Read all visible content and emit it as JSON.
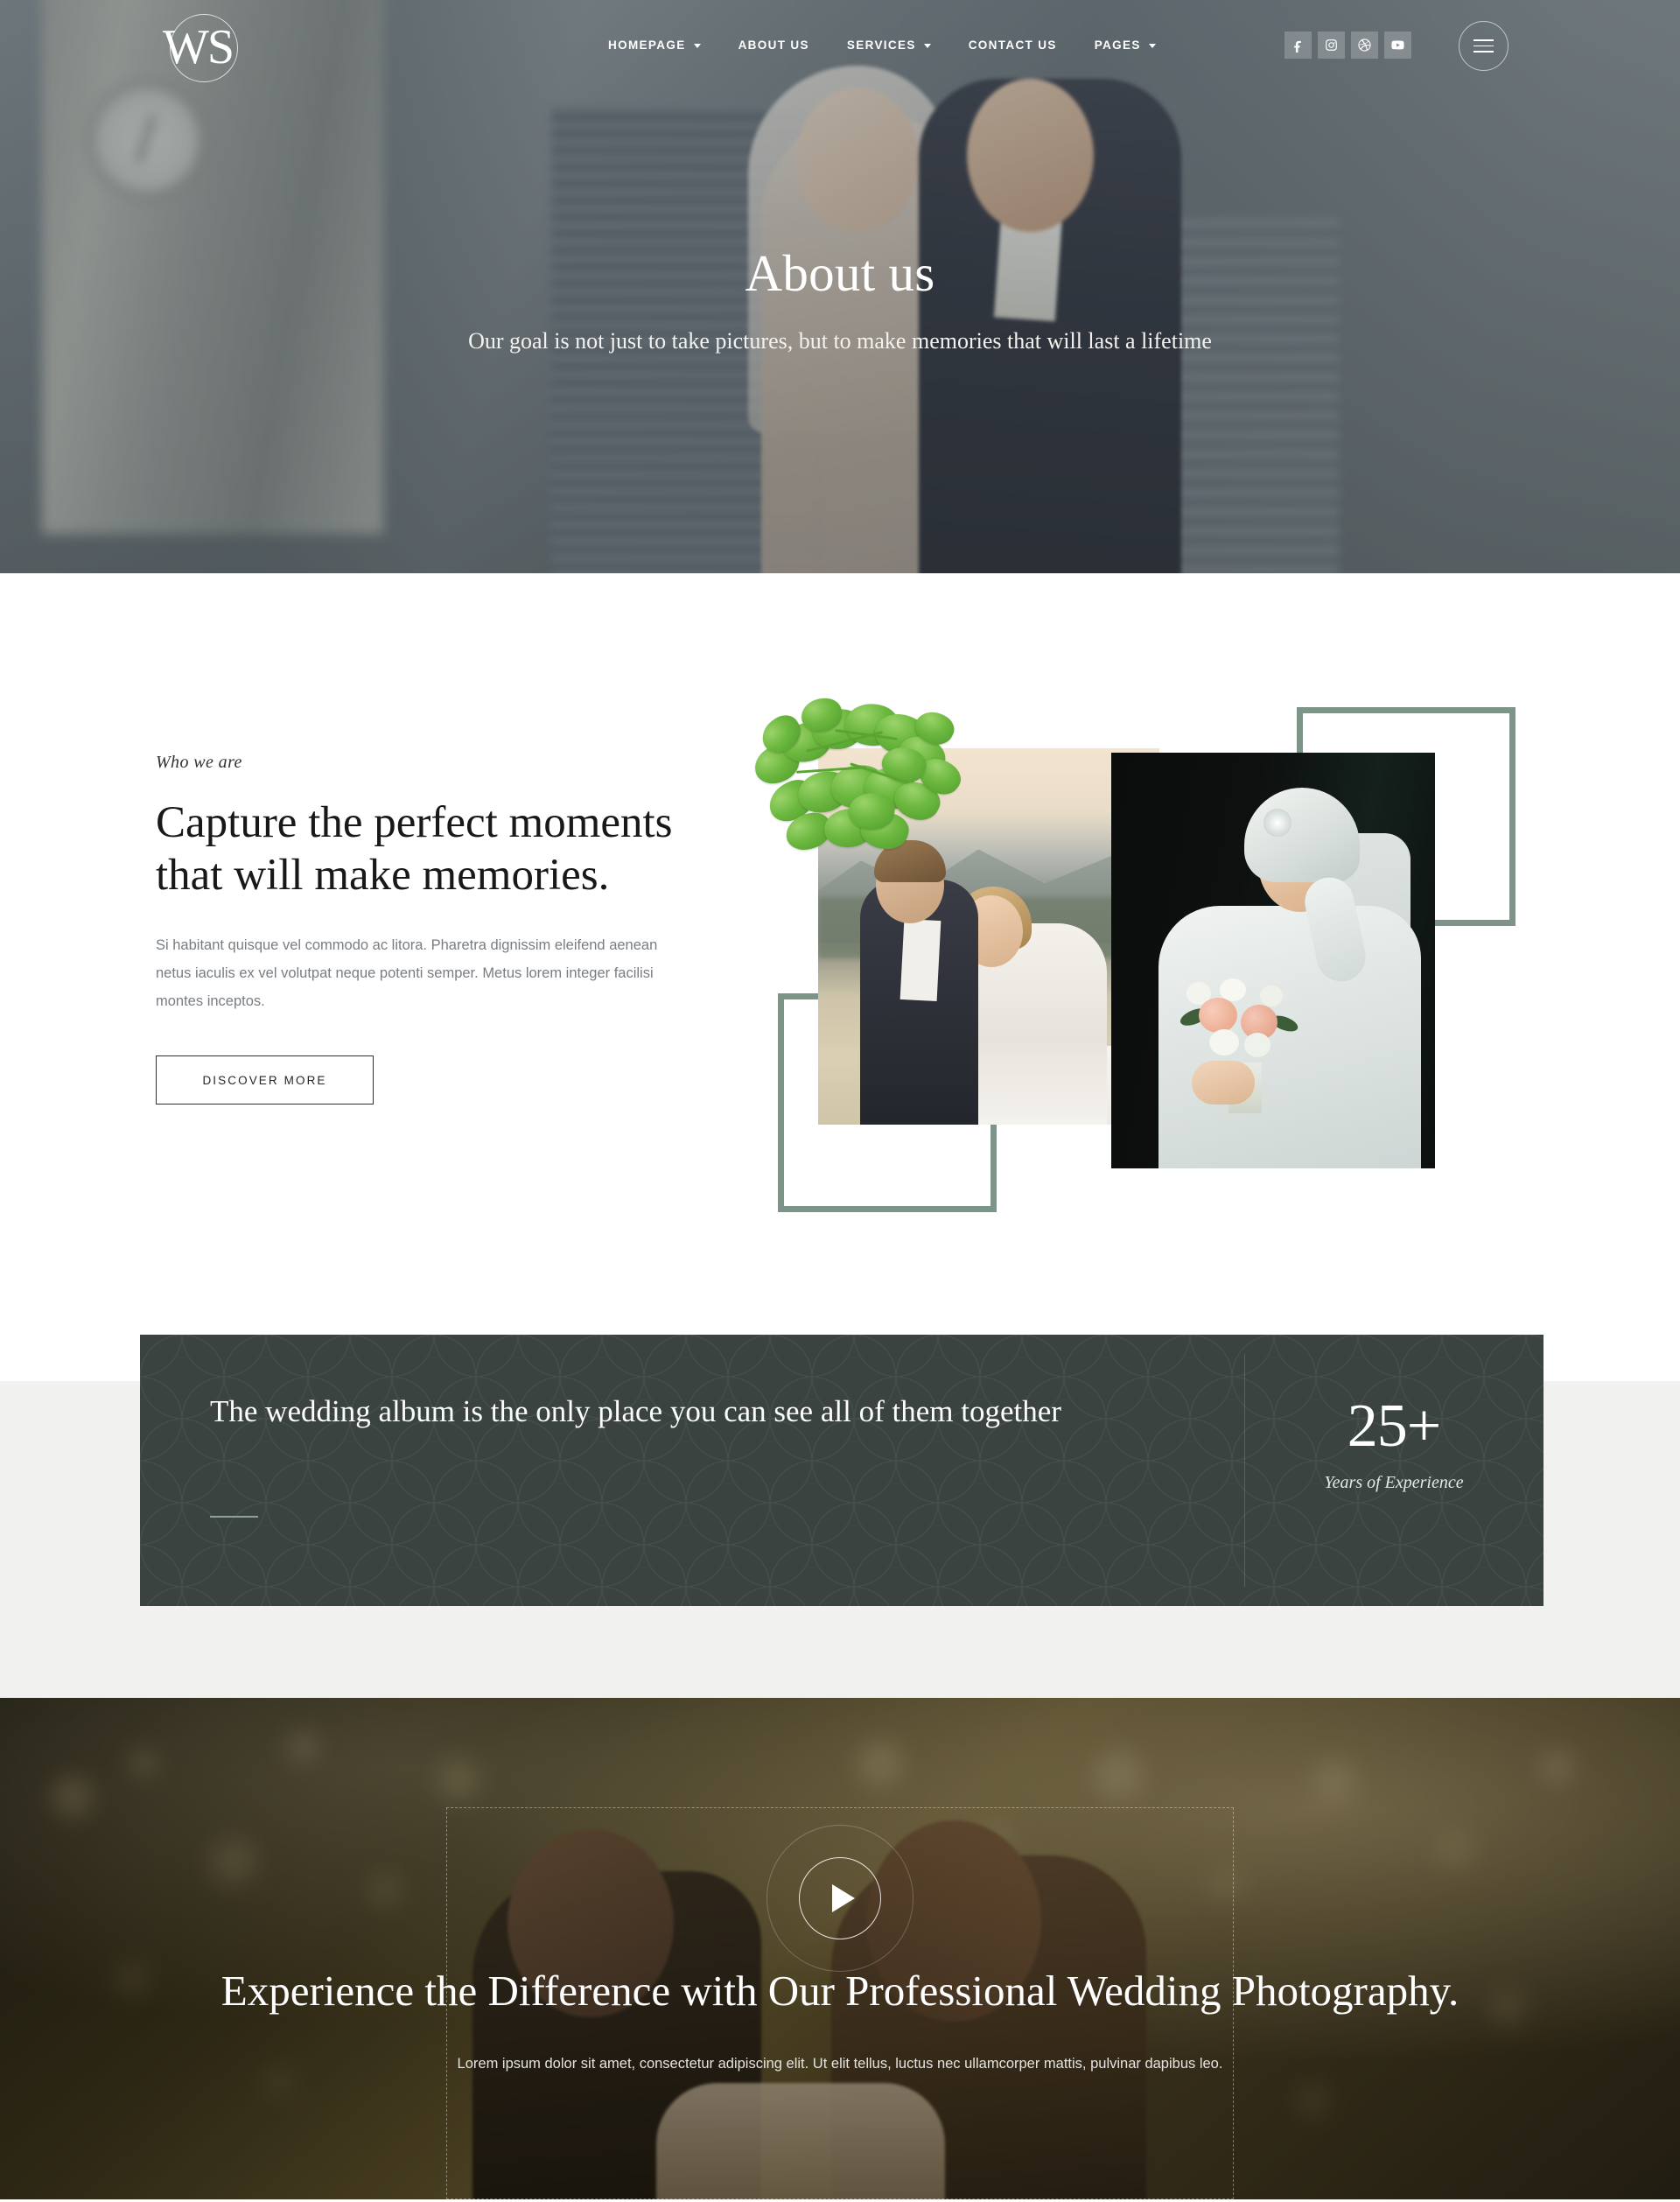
{
  "brand": {
    "logo_text": "WS"
  },
  "nav": {
    "items": [
      {
        "label": "HOMEPAGE",
        "has_caret": true
      },
      {
        "label": "ABOUT US",
        "has_caret": false
      },
      {
        "label": "SERVICES",
        "has_caret": true
      },
      {
        "label": "CONTACT US",
        "has_caret": false
      },
      {
        "label": "PAGES",
        "has_caret": true
      }
    ],
    "socials": [
      "facebook-icon",
      "instagram-icon",
      "dribbble-icon",
      "youtube-icon"
    ],
    "menu_toggle": "hamburger-icon"
  },
  "hero": {
    "title": "About us",
    "subtitle": "Our goal is not just to take pictures, but to make memories that will last a lifetime"
  },
  "about": {
    "eyebrow": "Who we are",
    "heading": "Capture the perfect moments that will make memories.",
    "paragraph": "Si habitant quisque vel commodo ac litora. Pharetra dignissim eleifend aenean netus iaculis ex vel volutpat neque potenti semper. Metus lorem integer facilisi montes inceptos.",
    "cta_label": "DISCOVER MORE"
  },
  "band": {
    "quote": "The wedding album is the only place you can see all of them together",
    "stat_number": "25+",
    "stat_label": "Years of Experience"
  },
  "video": {
    "heading": "Experience the Difference with Our Professional Wedding Photography.",
    "paragraph": "Lorem ipsum dolor sit amet, consectetur adipiscing elit. Ut elit tellus, luctus nec ullamcorper mattis, pulvinar dapibus leo.",
    "play_label": "play-icon"
  },
  "colors": {
    "accent_sage": "#7d9489",
    "dark_band": "#3a4340",
    "light_section": "#f1f2f0",
    "text_dark": "#16181a",
    "text_muted": "#787d82"
  }
}
